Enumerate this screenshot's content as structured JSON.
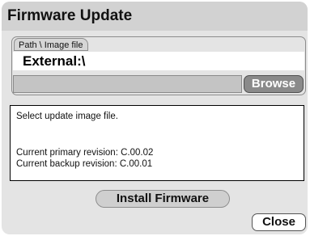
{
  "dialog": {
    "title": "Firmware Update"
  },
  "path_group": {
    "label": "Path \\ Image file",
    "current_path": "External:\\",
    "file_input_value": "",
    "browse_label": "Browse"
  },
  "message": {
    "line1": "Select update image file.",
    "line2": "Current primary revision: C.00.02",
    "line3": "Current backup revision: C.00.01"
  },
  "actions": {
    "install_label": "Install Firmware",
    "close_label": "Close"
  }
}
